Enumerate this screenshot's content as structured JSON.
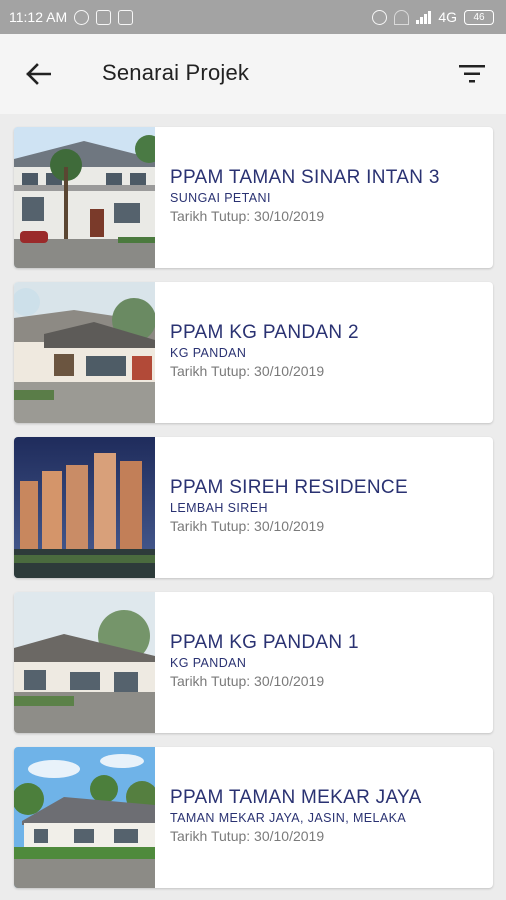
{
  "status_bar": {
    "time": "11:12 AM",
    "network": "4G",
    "battery": "46"
  },
  "header": {
    "title": "Senarai Projek",
    "back_icon": "arrow-left-icon",
    "filter_icon": "filter-list-icon"
  },
  "closing_label": "Tarikh Tutup:",
  "projects": [
    {
      "name": "PPAM TAMAN SINAR INTAN 3",
      "location": "SUNGAI PETANI",
      "closing_date": "30/10/2019"
    },
    {
      "name": "PPAM KG PANDAN 2",
      "location": "KG PANDAN",
      "closing_date": "30/10/2019"
    },
    {
      "name": "PPAM SIREH RESIDENCE",
      "location": "LEMBAH SIREH",
      "closing_date": "30/10/2019"
    },
    {
      "name": "PPAM KG PANDAN 1",
      "location": "KG PANDAN",
      "closing_date": "30/10/2019"
    },
    {
      "name": "PPAM TAMAN MEKAR JAYA",
      "location": "TAMAN MEKAR JAYA, JASIN, MELAKA",
      "closing_date": "30/10/2019"
    }
  ]
}
